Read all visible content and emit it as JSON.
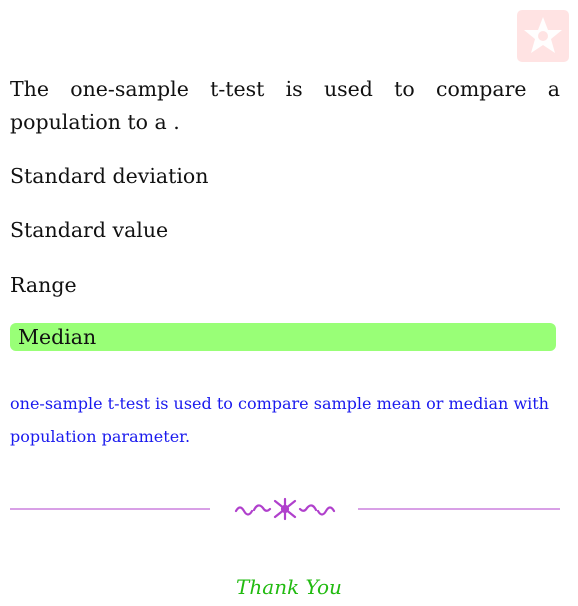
{
  "question": {
    "text": "The one-sample t-test is used to compare a population to a ."
  },
  "options": [
    {
      "label": "Standard deviation",
      "selected": false
    },
    {
      "label": "Standard value",
      "selected": false
    },
    {
      "label": "Range",
      "selected": false
    },
    {
      "label": "Median",
      "selected": true
    }
  ],
  "explanation": {
    "text": "one-sample t-test is used to compare sample mean or median with population parameter."
  },
  "footer": {
    "thanks": "Thank You"
  },
  "colors": {
    "selected_highlight": "#99ff77",
    "explanation_text": "#1a1aee",
    "divider": "#b040cc",
    "thanks_text": "#22bb11",
    "logo": "#ffe0e0"
  },
  "icons": {
    "logo": "star-logo-icon",
    "divider_ornament": "flourish-ornament-icon"
  }
}
